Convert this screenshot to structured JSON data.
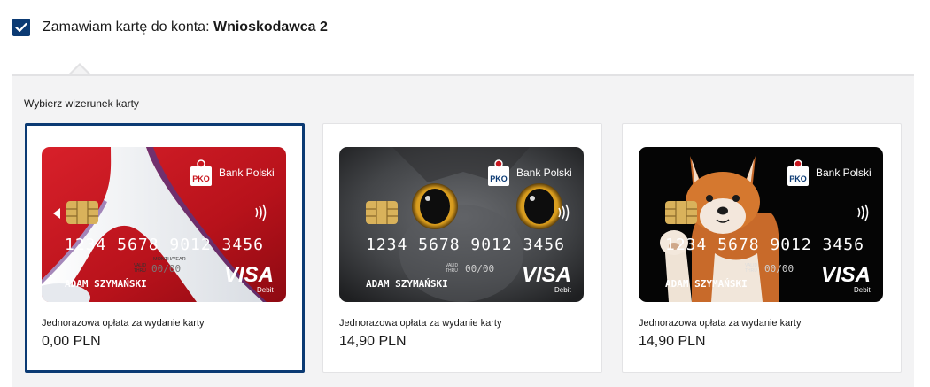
{
  "order": {
    "label": "Zamawiam kartę do konta:",
    "account_name": "Wnioskodawca 2",
    "checked": true
  },
  "card_selection": {
    "title": "Wybierz wizerunek karty",
    "options": [
      {
        "design": "red-white",
        "selected": true,
        "fee_label": "Jednorazowa opłata za wydanie karty",
        "fee": "0,00 PLN",
        "card": {
          "bank": "Bank Polski",
          "number": "1234 5678 9012 3456",
          "valid_thru_label_top": "MONTH/YEAR",
          "valid_label": "VALID",
          "thru_label": "THRU",
          "expiry": "00/00",
          "holder": "ADAM SZYMAŃSKI",
          "network": "VISA",
          "network_sub": "Debit"
        }
      },
      {
        "design": "cat",
        "selected": false,
        "fee_label": "Jednorazowa opłata za wydanie karty",
        "fee": "14,90 PLN",
        "card": {
          "bank": "Bank Polski",
          "number": "1234 5678 9012 3456",
          "valid_label": "VALID",
          "thru_label": "THRU",
          "expiry": "00/00",
          "holder": "ADAM SZYMAŃSKI",
          "network": "VISA",
          "network_sub": "Debit"
        }
      },
      {
        "design": "shiba-dog",
        "selected": false,
        "fee_label": "Jednorazowa opłata za wydanie karty",
        "fee": "14,90 PLN",
        "card": {
          "bank": "Bank Polski",
          "number": "1234 5678 9012 3456",
          "valid_label": "VALID",
          "thru_label": "THRU",
          "expiry": "00/00",
          "holder": "ADAM SZYMAŃSKI",
          "network": "VISA",
          "network_sub": "Debit"
        }
      }
    ]
  },
  "colors": {
    "brand_navy": "#0b3a73",
    "panel_bg": "#f3f3f4",
    "card_red": "#c8161e"
  }
}
